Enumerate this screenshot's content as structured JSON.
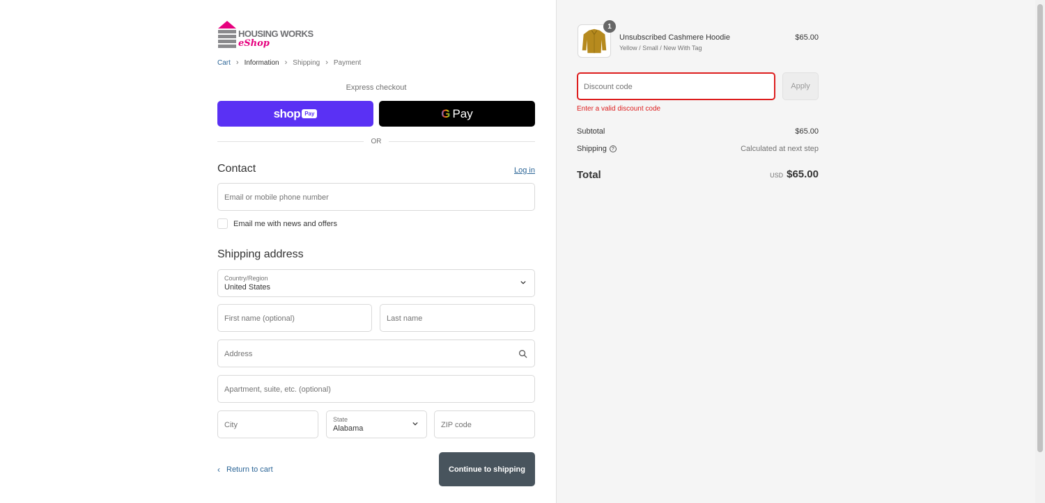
{
  "logo": {
    "line1": "HOUSING WORKS",
    "line2": "eShop",
    "pink": "#e6007e",
    "gray": "#6d6e71"
  },
  "breadcrumb": {
    "items": [
      "Cart",
      "Information",
      "Shipping",
      "Payment"
    ]
  },
  "express": {
    "title": "Express checkout",
    "shoppay_label": "shop",
    "shoppay_badge": "Pay",
    "gpay_g": "G",
    "gpay_label": "Pay",
    "or_label": "OR"
  },
  "contact": {
    "title": "Contact",
    "login_label": "Log in",
    "email_placeholder": "Email or mobile phone number",
    "newsletter_label": "Email me with news and offers"
  },
  "shipping": {
    "title": "Shipping address",
    "country_label": "Country/Region",
    "country_value": "United States",
    "first_name_placeholder": "First name (optional)",
    "last_name_placeholder": "Last name",
    "address_placeholder": "Address",
    "apartment_placeholder": "Apartment, suite, etc. (optional)",
    "city_placeholder": "City",
    "state_label": "State",
    "state_value": "Alabama",
    "zip_placeholder": "ZIP code"
  },
  "actions": {
    "return_label": "Return to cart",
    "continue_label": "Continue to shipping"
  },
  "summary": {
    "item": {
      "quantity": "1",
      "name": "Unsubscribed Cashmere Hoodie",
      "variant": "Yellow / Small / New With Tag",
      "price": "$65.00"
    },
    "discount_placeholder": "Discount code",
    "apply_label": "Apply",
    "discount_error": "Enter a valid discount code",
    "subtotal_label": "Subtotal",
    "subtotal_value": "$65.00",
    "shipping_label": "Shipping",
    "shipping_value": "Calculated at next step",
    "total_label": "Total",
    "total_currency": "USD",
    "total_value": "$65.00"
  },
  "colors": {
    "accent": "#2a6496",
    "error": "#dd1d1d",
    "shoppay": "#5a31f4",
    "continue_bg": "#48545d"
  }
}
